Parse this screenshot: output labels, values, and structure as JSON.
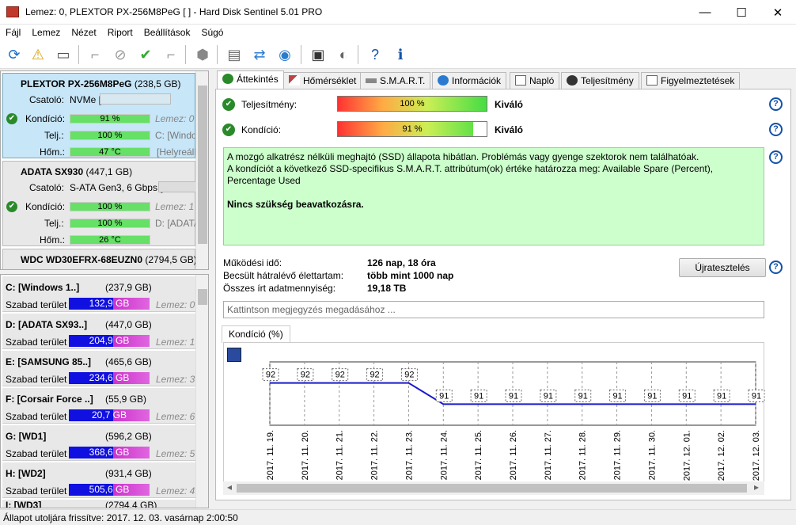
{
  "window": {
    "title": "Lemez: 0, PLEXTOR PX-256M8PeG [                ] - Hard Disk Sentinel 5.01 PRO"
  },
  "menu": [
    "Fájl",
    "Lemez",
    "Nézet",
    "Riport",
    "Beállítások",
    "Súgó"
  ],
  "disks": [
    {
      "name": "PLEXTOR PX-256M8PeG",
      "size": "(238,5 GB)",
      "conn_label": "Csatoló:",
      "conn": "NVMe [",
      "cond_label": "Kondíció:",
      "cond": "91 %",
      "cond_disk": "Lemez: 0",
      "perf_label": "Telj.:",
      "perf": "100 %",
      "perf_vol": "C: [Windo",
      "temp_label": "Hőm.:",
      "temp": "47 °C",
      "temp_note": "[Helyreállí"
    },
    {
      "name": "ADATA SX930",
      "size": "(447,1 GB)",
      "conn_label": "Csatoló:",
      "conn": "S-ATA Gen3, 6 Gbps [",
      "cond_label": "Kondíció:",
      "cond": "100 %",
      "cond_disk": "Lemez: 1",
      "perf_label": "Telj.:",
      "perf": "100 %",
      "perf_vol": "D: [ADATA",
      "temp_label": "Hőm.:",
      "temp": "26 °C",
      "temp_note": ""
    },
    {
      "name": "WDC WD30EFRX-68EUZN0",
      "size": "(2794,5 GB)"
    }
  ],
  "partitions": [
    {
      "name": "C: [Windows 1..]",
      "size": "(237,9 GB)",
      "free_label": "Szabad terület",
      "free": "132,9 GB",
      "disk": "Lemez: 0"
    },
    {
      "name": "D: [ADATA SX93..]",
      "size": "(447,0 GB)",
      "free_label": "Szabad terület",
      "free": "204,9 GB",
      "disk": "Lemez: 1"
    },
    {
      "name": "E: [SAMSUNG 85..]",
      "size": "(465,6 GB)",
      "free_label": "Szabad terület",
      "free": "234,6 GB",
      "disk": "Lemez: 3"
    },
    {
      "name": "F: [Corsair Force ..]",
      "size": "(55,9 GB)",
      "free_label": "Szabad terület",
      "free": "20,7 GB",
      "disk": "Lemez: 6"
    },
    {
      "name": "G: [WD1]",
      "size": "(596,2 GB)",
      "free_label": "Szabad terület",
      "free": "368,6 GB",
      "disk": "Lemez: 5"
    },
    {
      "name": "H: [WD2]",
      "size": "(931,4 GB)",
      "free_label": "Szabad terület",
      "free": "505,6 GB",
      "disk": "Lemez: 4"
    },
    {
      "name": "I: [WD3]",
      "size": "(2794,4 GB)"
    }
  ],
  "tabs": [
    "Áttekintés",
    "Hőmérséklet",
    "S.M.A.R.T.",
    "Információk",
    "Napló",
    "Teljesítmény",
    "Figyelmeztetések"
  ],
  "overview": {
    "perf_label": "Teljesítmény:",
    "perf_value": "100 %",
    "perf_fraction": 1.0,
    "perf_rating": "Kiváló",
    "cond_label": "Kondíció:",
    "cond_value": "91 %",
    "cond_fraction": 0.91,
    "cond_rating": "Kiváló",
    "status_line1": "A mozgó alkatrész nélküli meghajtó (SSD) állapota hibátlan. Problémás vagy gyenge szektorok nem találhatóak.",
    "status_line2": "A kondíciót a következő SSD-specifikus S.M.A.R.T. attribútum(ok) értéke határozza meg:  Available Spare (Percent), Percentage Used",
    "status_bold": "Nincs szükség beavatkozásra.",
    "uptime_label": "Működési idő:",
    "uptime": "126 nap, 18 óra",
    "life_label": "Becsült hátralévő élettartam:",
    "life": "több mint 1000 nap",
    "written_label": "Összes írt adatmennyiség:",
    "written": "19,18 TB",
    "retest_button": "Újratesztelés",
    "comment_placeholder": "Kattintson megjegyzés megadásához ...",
    "chart_tab": "Kondíció  (%)"
  },
  "chart_data": {
    "type": "line",
    "title": "Kondíció  (%)",
    "x": [
      "2017. 11. 19.",
      "2017. 11. 20.",
      "2017. 11. 21.",
      "2017. 11. 22.",
      "2017. 11. 23.",
      "2017. 11. 24.",
      "2017. 11. 25.",
      "2017. 11. 26.",
      "2017. 11. 27.",
      "2017. 11. 28.",
      "2017. 11. 29.",
      "2017. 11. 30.",
      "2017. 12. 01.",
      "2017. 12. 02.",
      "2017. 12. 03."
    ],
    "values": [
      92,
      92,
      92,
      92,
      92,
      91,
      91,
      91,
      91,
      91,
      91,
      91,
      91,
      91,
      91
    ],
    "ylim": [
      90,
      93
    ],
    "grid": true,
    "line_color": "#1a1acc"
  },
  "status_bar": "Állapot utoljára frissítve: 2017. 12. 03. vasárnap 2:00:50"
}
